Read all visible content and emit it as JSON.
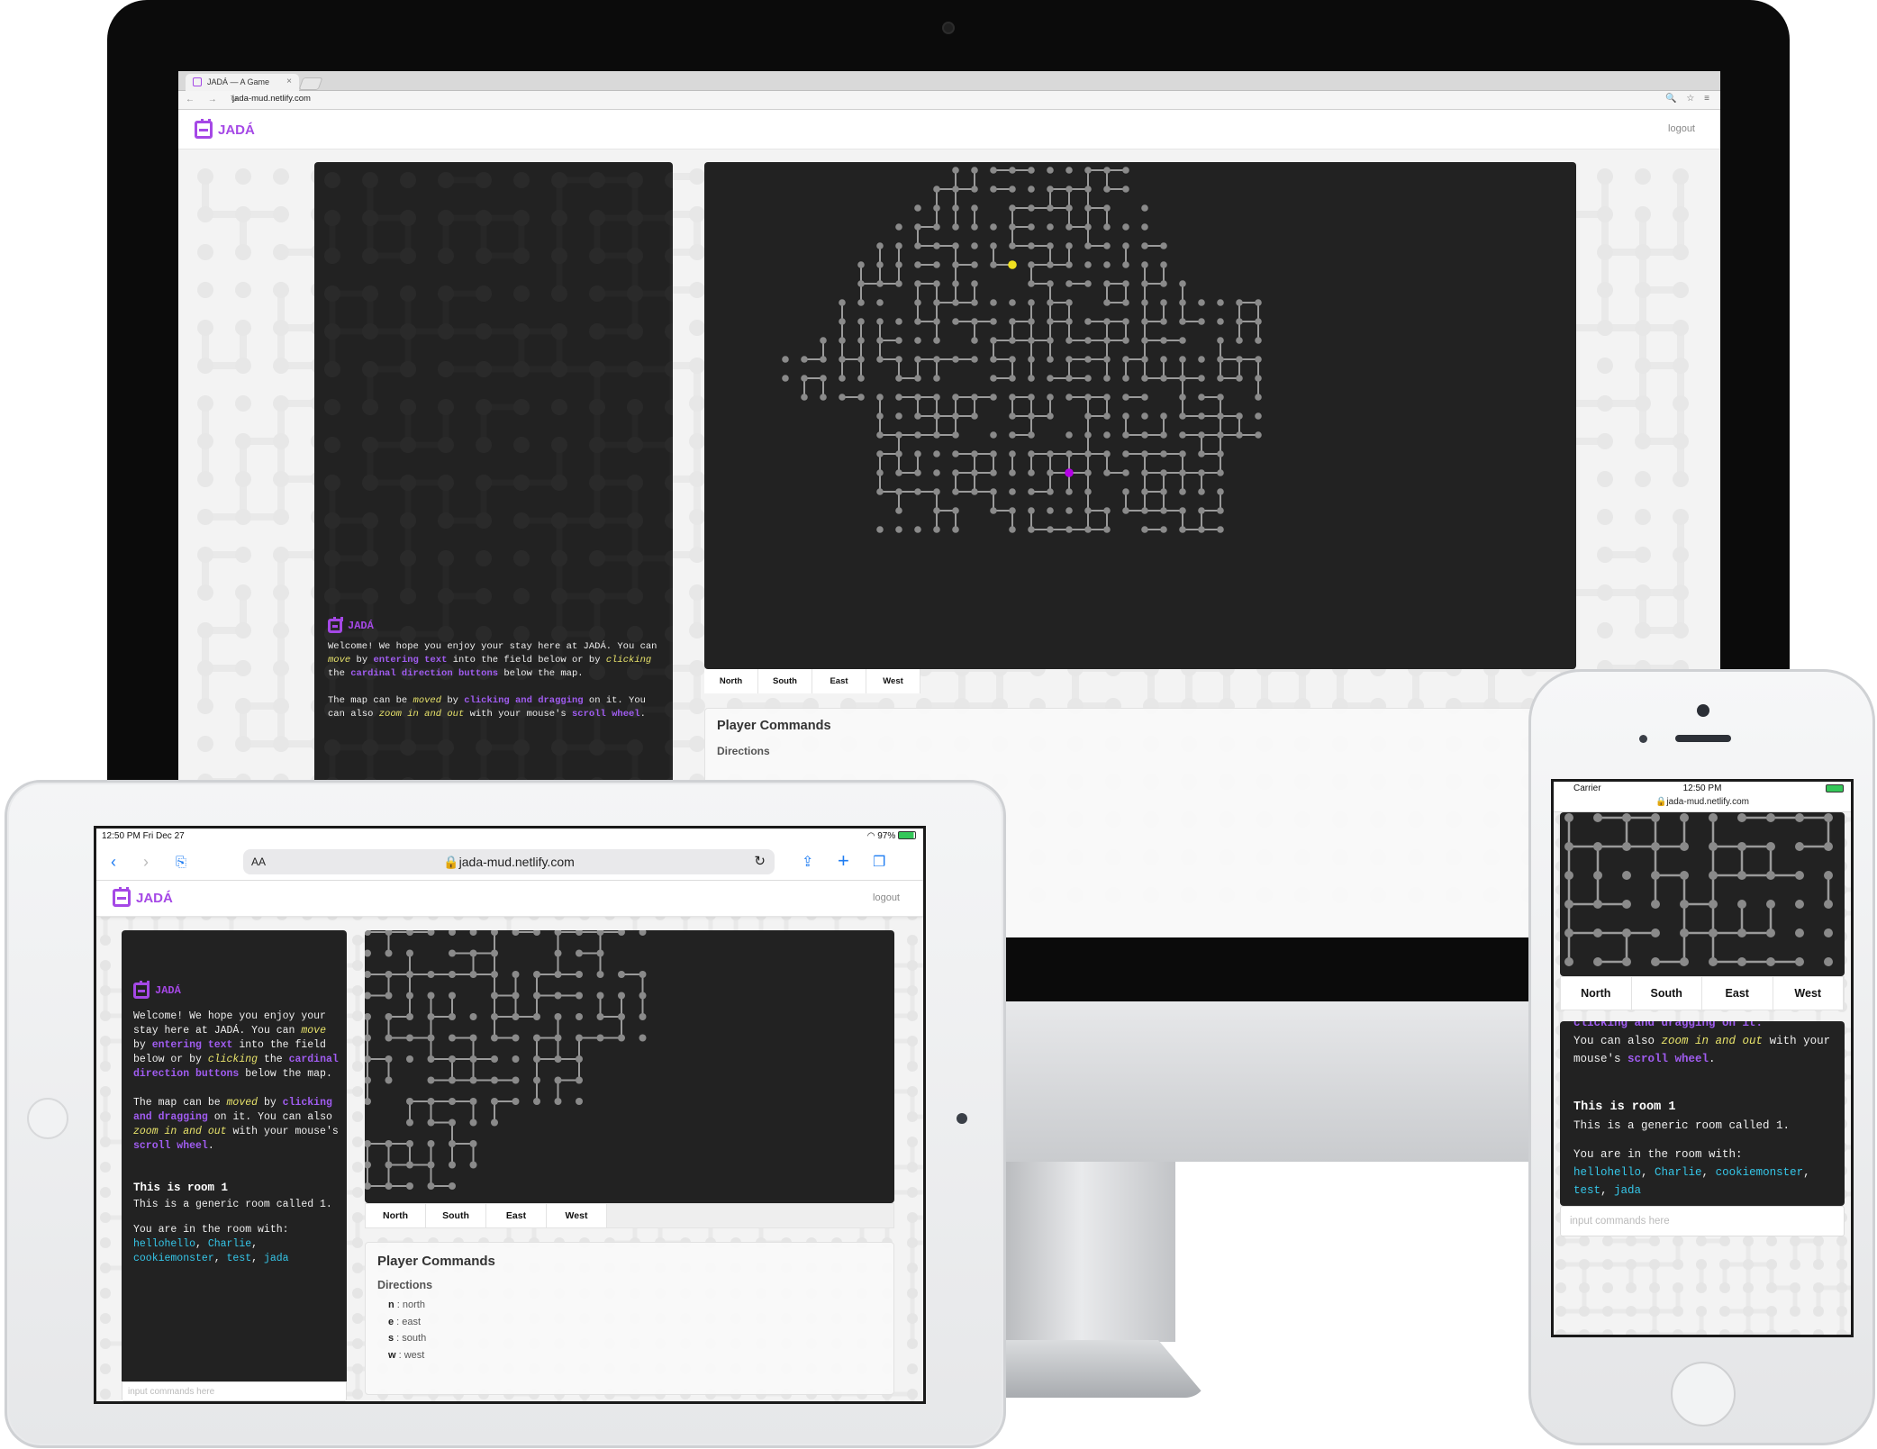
{
  "app": {
    "name": "JADÁ"
  },
  "desktop": {
    "tab_title": "JADÁ — A Game",
    "url": "jada-mud.netlify.com",
    "nav_glyphs": "← → ↻",
    "tool_glyphs": "🔍 ☆ ≡",
    "logout": "logout",
    "welcome": {
      "line1": "Welcome! We hope you enjoy your stay here at JADÁ.",
      "you_can": "You can",
      "move": "move",
      "by": "by",
      "entering_text": "entering text",
      "into_field": "into the field below or by",
      "clicking": "clicking",
      "the": "the",
      "cardinal": "cardinal direction buttons",
      "below_map": "below the map.",
      "map_can_be": "The map can be",
      "moved": "moved",
      "clicking_dragging": "clicking and dragging",
      "on_it": "on it.",
      "you_can_also": "You can also",
      "zoom": "zoom in and out",
      "with_mouse": "with your mouse's",
      "scroll": "scroll wheel",
      "period": "."
    },
    "directions": [
      "North",
      "South",
      "East",
      "West"
    ],
    "player_commands": "Player Commands",
    "directions_label": "Directions"
  },
  "ipad": {
    "status_left": "12:50 PM   Fri Dec 27",
    "status_right": "97%",
    "aa": "AA",
    "url": "jada-mud.netlify.com",
    "logout": "logout",
    "room_title": "This is room 1",
    "room_desc": "This is a generic room called 1.",
    "room_with": "You are in the room with:",
    "players": [
      "hellohello",
      "Charlie",
      "cookiemonster",
      "test",
      "jada"
    ],
    "input_placeholder": "input commands here",
    "player_commands": "Player Commands",
    "directions_label": "Directions",
    "dir_list": [
      {
        "key": "n",
        "label": "north"
      },
      {
        "key": "e",
        "label": "east"
      },
      {
        "key": "s",
        "label": "south"
      },
      {
        "key": "w",
        "label": "west"
      }
    ]
  },
  "iphone": {
    "carrier": "Carrier",
    "time": "12:50 PM",
    "url": "jada-mud.netlify.com",
    "partial_line": "clicking and dragging on it.",
    "you_can_also": "You can also",
    "zoom": "zoom in and out",
    "with_mouse": "with your mouse's",
    "scroll": "scroll wheel",
    "room_title": "This is room 1",
    "room_desc": "This is a generic room called 1.",
    "room_with": "You are in the room with:",
    "input_placeholder": "input commands here"
  },
  "colors": {
    "brand": "#a548e6",
    "player_node": "#f0e020",
    "target_node": "#b400e6",
    "node": "#8a8a8a",
    "panel": "#222222",
    "link": "#35c6e8"
  }
}
